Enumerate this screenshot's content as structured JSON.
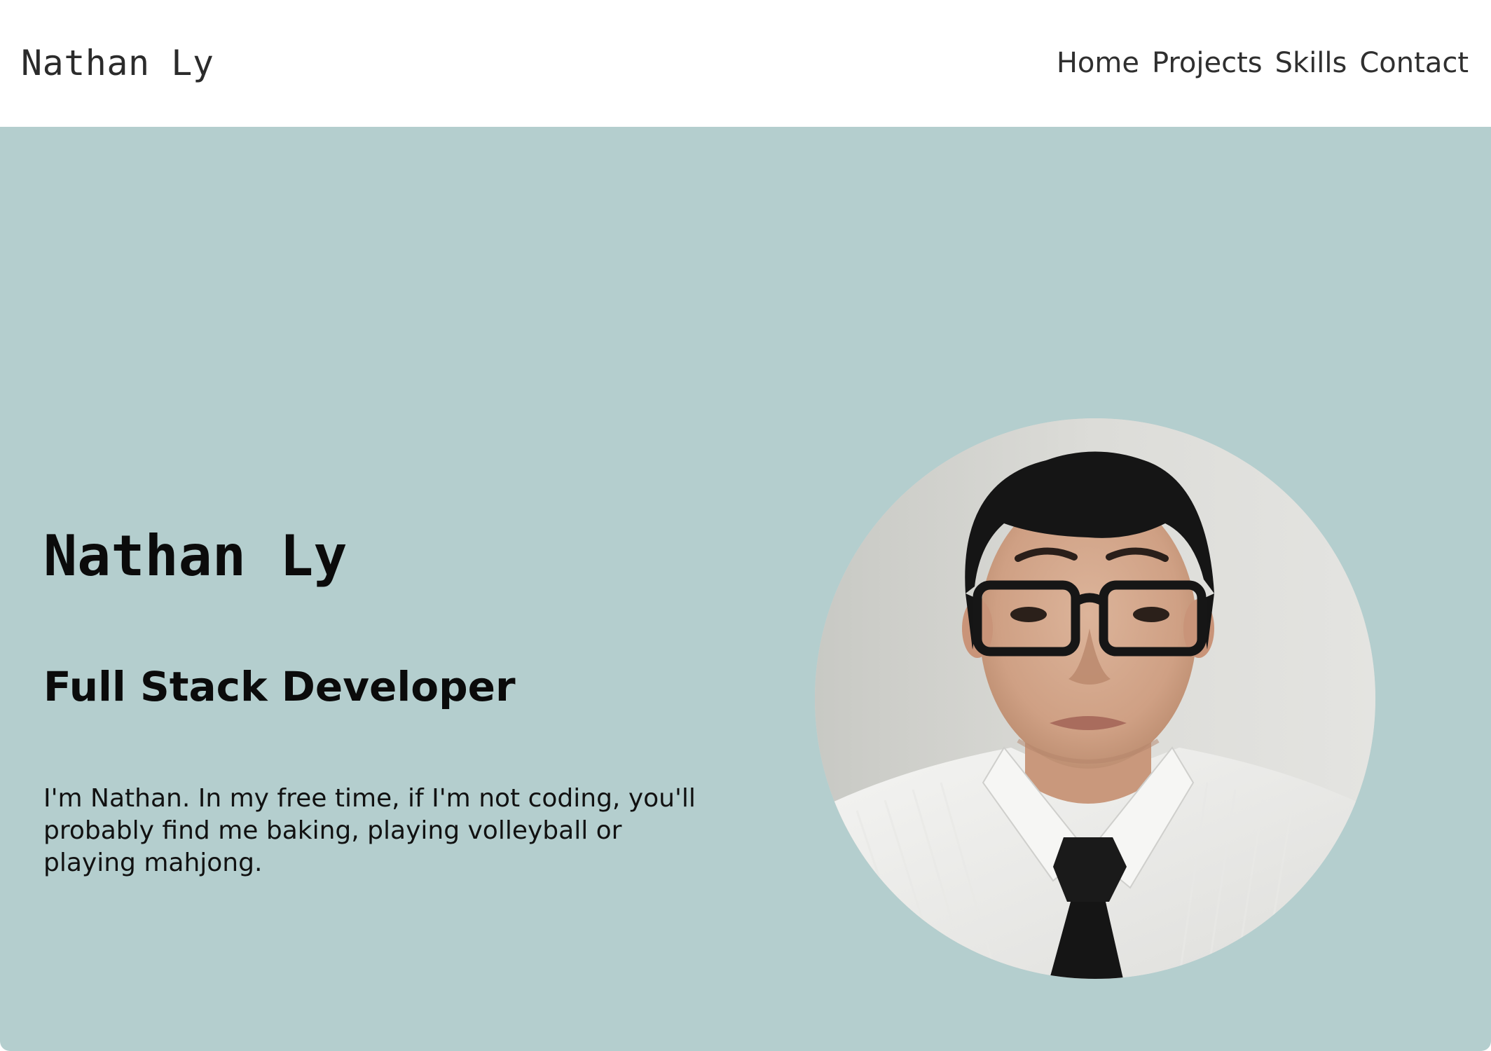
{
  "header": {
    "brand": "Nathan Ly",
    "nav": [
      {
        "label": "Home"
      },
      {
        "label": "Projects"
      },
      {
        "label": "Skills"
      },
      {
        "label": "Contact"
      }
    ]
  },
  "hero": {
    "name": "Nathan Ly",
    "role": "Full Stack Developer",
    "bio": "I'm Nathan. In my free time, if I'm not coding, you'll probably find me baking, playing volleyball or playing mahjong.",
    "background_color": "#b4cece"
  },
  "colors": {
    "header_bg": "#ffffff",
    "hero_bg": "#b4cece",
    "text": "#0b0b0b"
  }
}
